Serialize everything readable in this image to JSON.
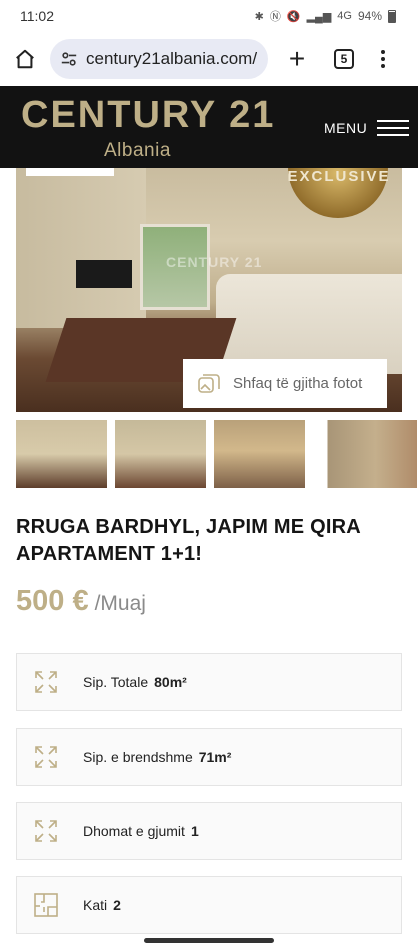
{
  "status": {
    "time": "11:02",
    "battery": "94%",
    "network_badge": "4G"
  },
  "browser": {
    "url": "century21albania.com/",
    "tab_count": "5"
  },
  "header": {
    "logo": "CENTURY 21",
    "logo_sub": "Albania",
    "menu_label": "MENU"
  },
  "gallery": {
    "badge": "EXCLUSIVE",
    "watermark": "CENTURY 21",
    "show_all_photos": "Shfaq të gjitha fotot"
  },
  "listing": {
    "title": "RRUGA BARDHYL, JAPIM ME QIRA APARTAMENT 1+1!",
    "price": "500 €",
    "price_period": "/Muaj",
    "features": [
      {
        "icon": "expand-arrows-icon",
        "label": "Sip. Totale",
        "value": "80m²"
      },
      {
        "icon": "expand-arrows-icon",
        "label": "Sip. e brendshme",
        "value": "71m²"
      },
      {
        "icon": "expand-arrows-icon",
        "label": "Dhomat e gjumit",
        "value": "1"
      },
      {
        "icon": "floor-plan-icon",
        "label": "Kati",
        "value": "2"
      }
    ]
  }
}
